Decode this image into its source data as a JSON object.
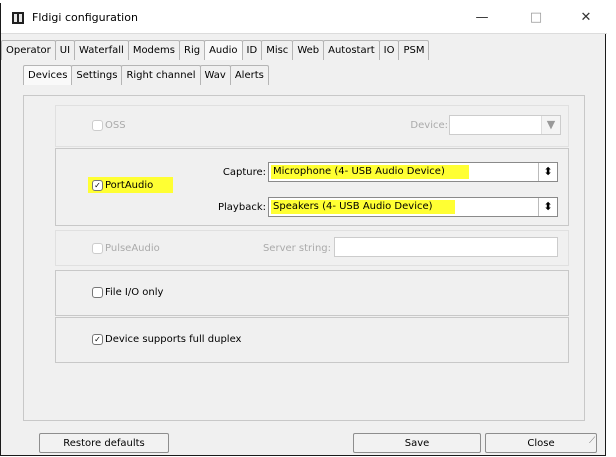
{
  "window": {
    "title": "Fldigi configuration",
    "minimize_glyph": "—",
    "maximize_glyph": "□",
    "close_glyph": "✕"
  },
  "main_tabs": [
    {
      "label": "Operator"
    },
    {
      "label": "UI"
    },
    {
      "label": "Waterfall"
    },
    {
      "label": "Modems"
    },
    {
      "label": "Rig"
    },
    {
      "label": "Audio"
    },
    {
      "label": "ID"
    },
    {
      "label": "Misc"
    },
    {
      "label": "Web"
    },
    {
      "label": "Autostart"
    },
    {
      "label": "IO"
    },
    {
      "label": "PSM"
    }
  ],
  "active_main_tab": "Audio",
  "sub_tabs": [
    {
      "label": "Devices"
    },
    {
      "label": "Settings"
    },
    {
      "label": "Right channel"
    },
    {
      "label": "Wav"
    },
    {
      "label": "Alerts"
    }
  ],
  "active_sub_tab": "Devices",
  "oss": {
    "label": "OSS",
    "checked": false,
    "device_label": "Device:",
    "device_value": ""
  },
  "portaudio": {
    "label": "PortAudio",
    "checked": true,
    "check_glyph": "✓",
    "capture_label": "Capture:",
    "capture_value": "Microphone (4- USB Audio Device)",
    "playback_label": "Playback:",
    "playback_value": "Speakers (4- USB Audio Device)",
    "spin_glyph": "⬍"
  },
  "pulseaudio": {
    "label": "PulseAudio",
    "checked": false,
    "server_label": "Server string:",
    "server_value": ""
  },
  "file_io": {
    "label": "File I/O only",
    "checked": false
  },
  "full_duplex": {
    "label": "Device supports full duplex",
    "checked": true,
    "check_glyph": "✓"
  },
  "buttons": {
    "restore": "Restore defaults",
    "save": "Save",
    "close": "Close"
  },
  "colors": {
    "highlight": "#ffff33",
    "background": "#f0f0f0"
  }
}
